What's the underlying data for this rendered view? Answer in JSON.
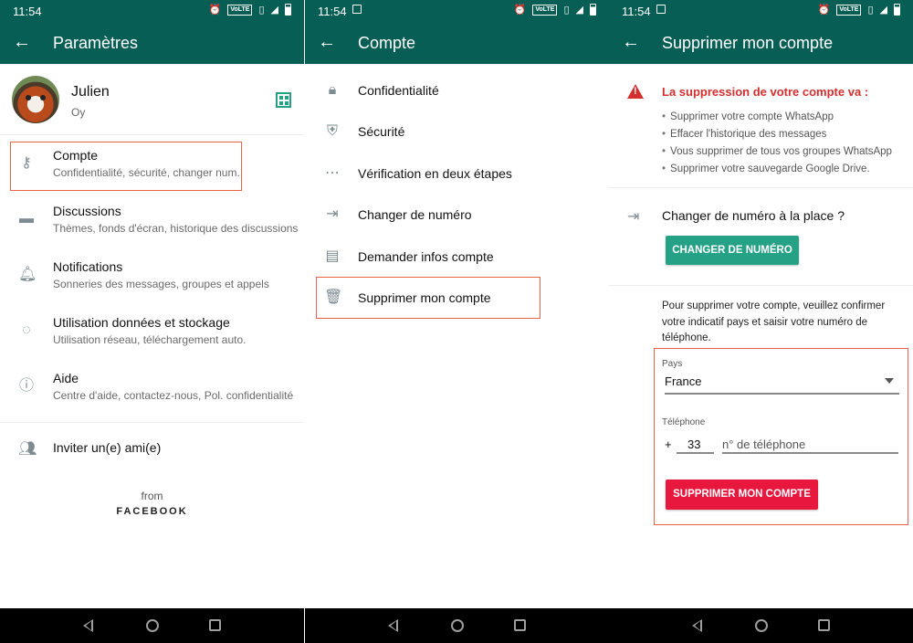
{
  "status": {
    "time": "11:54",
    "volte": "VoLTE"
  },
  "panel1": {
    "title": "Paramètres",
    "profile": {
      "name": "Julien",
      "status": "Oy"
    },
    "items": [
      {
        "title": "Compte",
        "subtitle": "Confidentialité, sécurité, changer num."
      },
      {
        "title": "Discussions",
        "subtitle": "Thèmes, fonds d'écran, historique des discussions"
      },
      {
        "title": "Notifications",
        "subtitle": "Sonneries des messages, groupes et appels"
      },
      {
        "title": "Utilisation données et stockage",
        "subtitle": "Utilisation réseau, téléchargement auto."
      },
      {
        "title": "Aide",
        "subtitle": "Centre d'aide, contactez-nous, Pol. confidentialité"
      }
    ],
    "invite": "Inviter un(e) ami(e)",
    "from": "from",
    "brand": "FACEBOOK"
  },
  "panel2": {
    "title": "Compte",
    "items": [
      "Confidentialité",
      "Sécurité",
      "Vérification en deux étapes",
      "Changer de numéro",
      "Demander infos compte",
      "Supprimer mon compte"
    ]
  },
  "panel3": {
    "title": "Supprimer mon compte",
    "warning": "La suppression de votre compte va :",
    "bullets": [
      "Supprimer votre compte WhatsApp",
      "Effacer l'historique des messages",
      "Vous supprimer de tous vos groupes WhatsApp",
      "Supprimer votre sauvegarde Google Drive."
    ],
    "change_title": "Changer de numéro à la place ?",
    "change_button": "CHANGER DE NUMÉRO",
    "confirm_text": "Pour supprimer votre compte, veuillez confirmer votre indicatif pays et saisir votre numéro de téléphone.",
    "country_label": "Pays",
    "country_value": "France",
    "phone_label": "Téléphone",
    "plus": "+",
    "country_code": "33",
    "phone_placeholder": "n° de téléphone",
    "delete_button": "SUPPRIMER MON COMPTE"
  },
  "colors": {
    "header": "#075e54",
    "accent": "#25a186",
    "danger": "#e8173d",
    "highlight": "#e8614a"
  }
}
